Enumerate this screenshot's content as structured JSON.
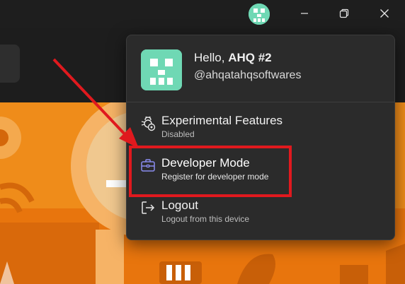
{
  "window": {
    "avatar_icon": "pixel-skull-avatar-icon",
    "minimize_icon": "minimize-icon",
    "maximize_icon": "restore-icon",
    "close_icon": "close-icon"
  },
  "profile": {
    "greeting": "Hello,",
    "display_name": "AHQ #2",
    "username": "@ahqatahqsoftwares"
  },
  "menu": {
    "items": [
      {
        "title": "Experimental Features",
        "subtitle": "Disabled",
        "icon": "bug-settings-icon"
      },
      {
        "title": "Developer Mode",
        "subtitle": "Register for developer mode",
        "icon": "briefcase-icon"
      },
      {
        "title": "Logout",
        "subtitle": "Logout from this device",
        "icon": "sign-out-icon"
      }
    ]
  },
  "colors": {
    "accent_avatar": "#6fd8b4",
    "banner_orange": "#ef8c1a",
    "highlight_red": "#e0191e",
    "developer_icon": "#8a8cf0"
  }
}
